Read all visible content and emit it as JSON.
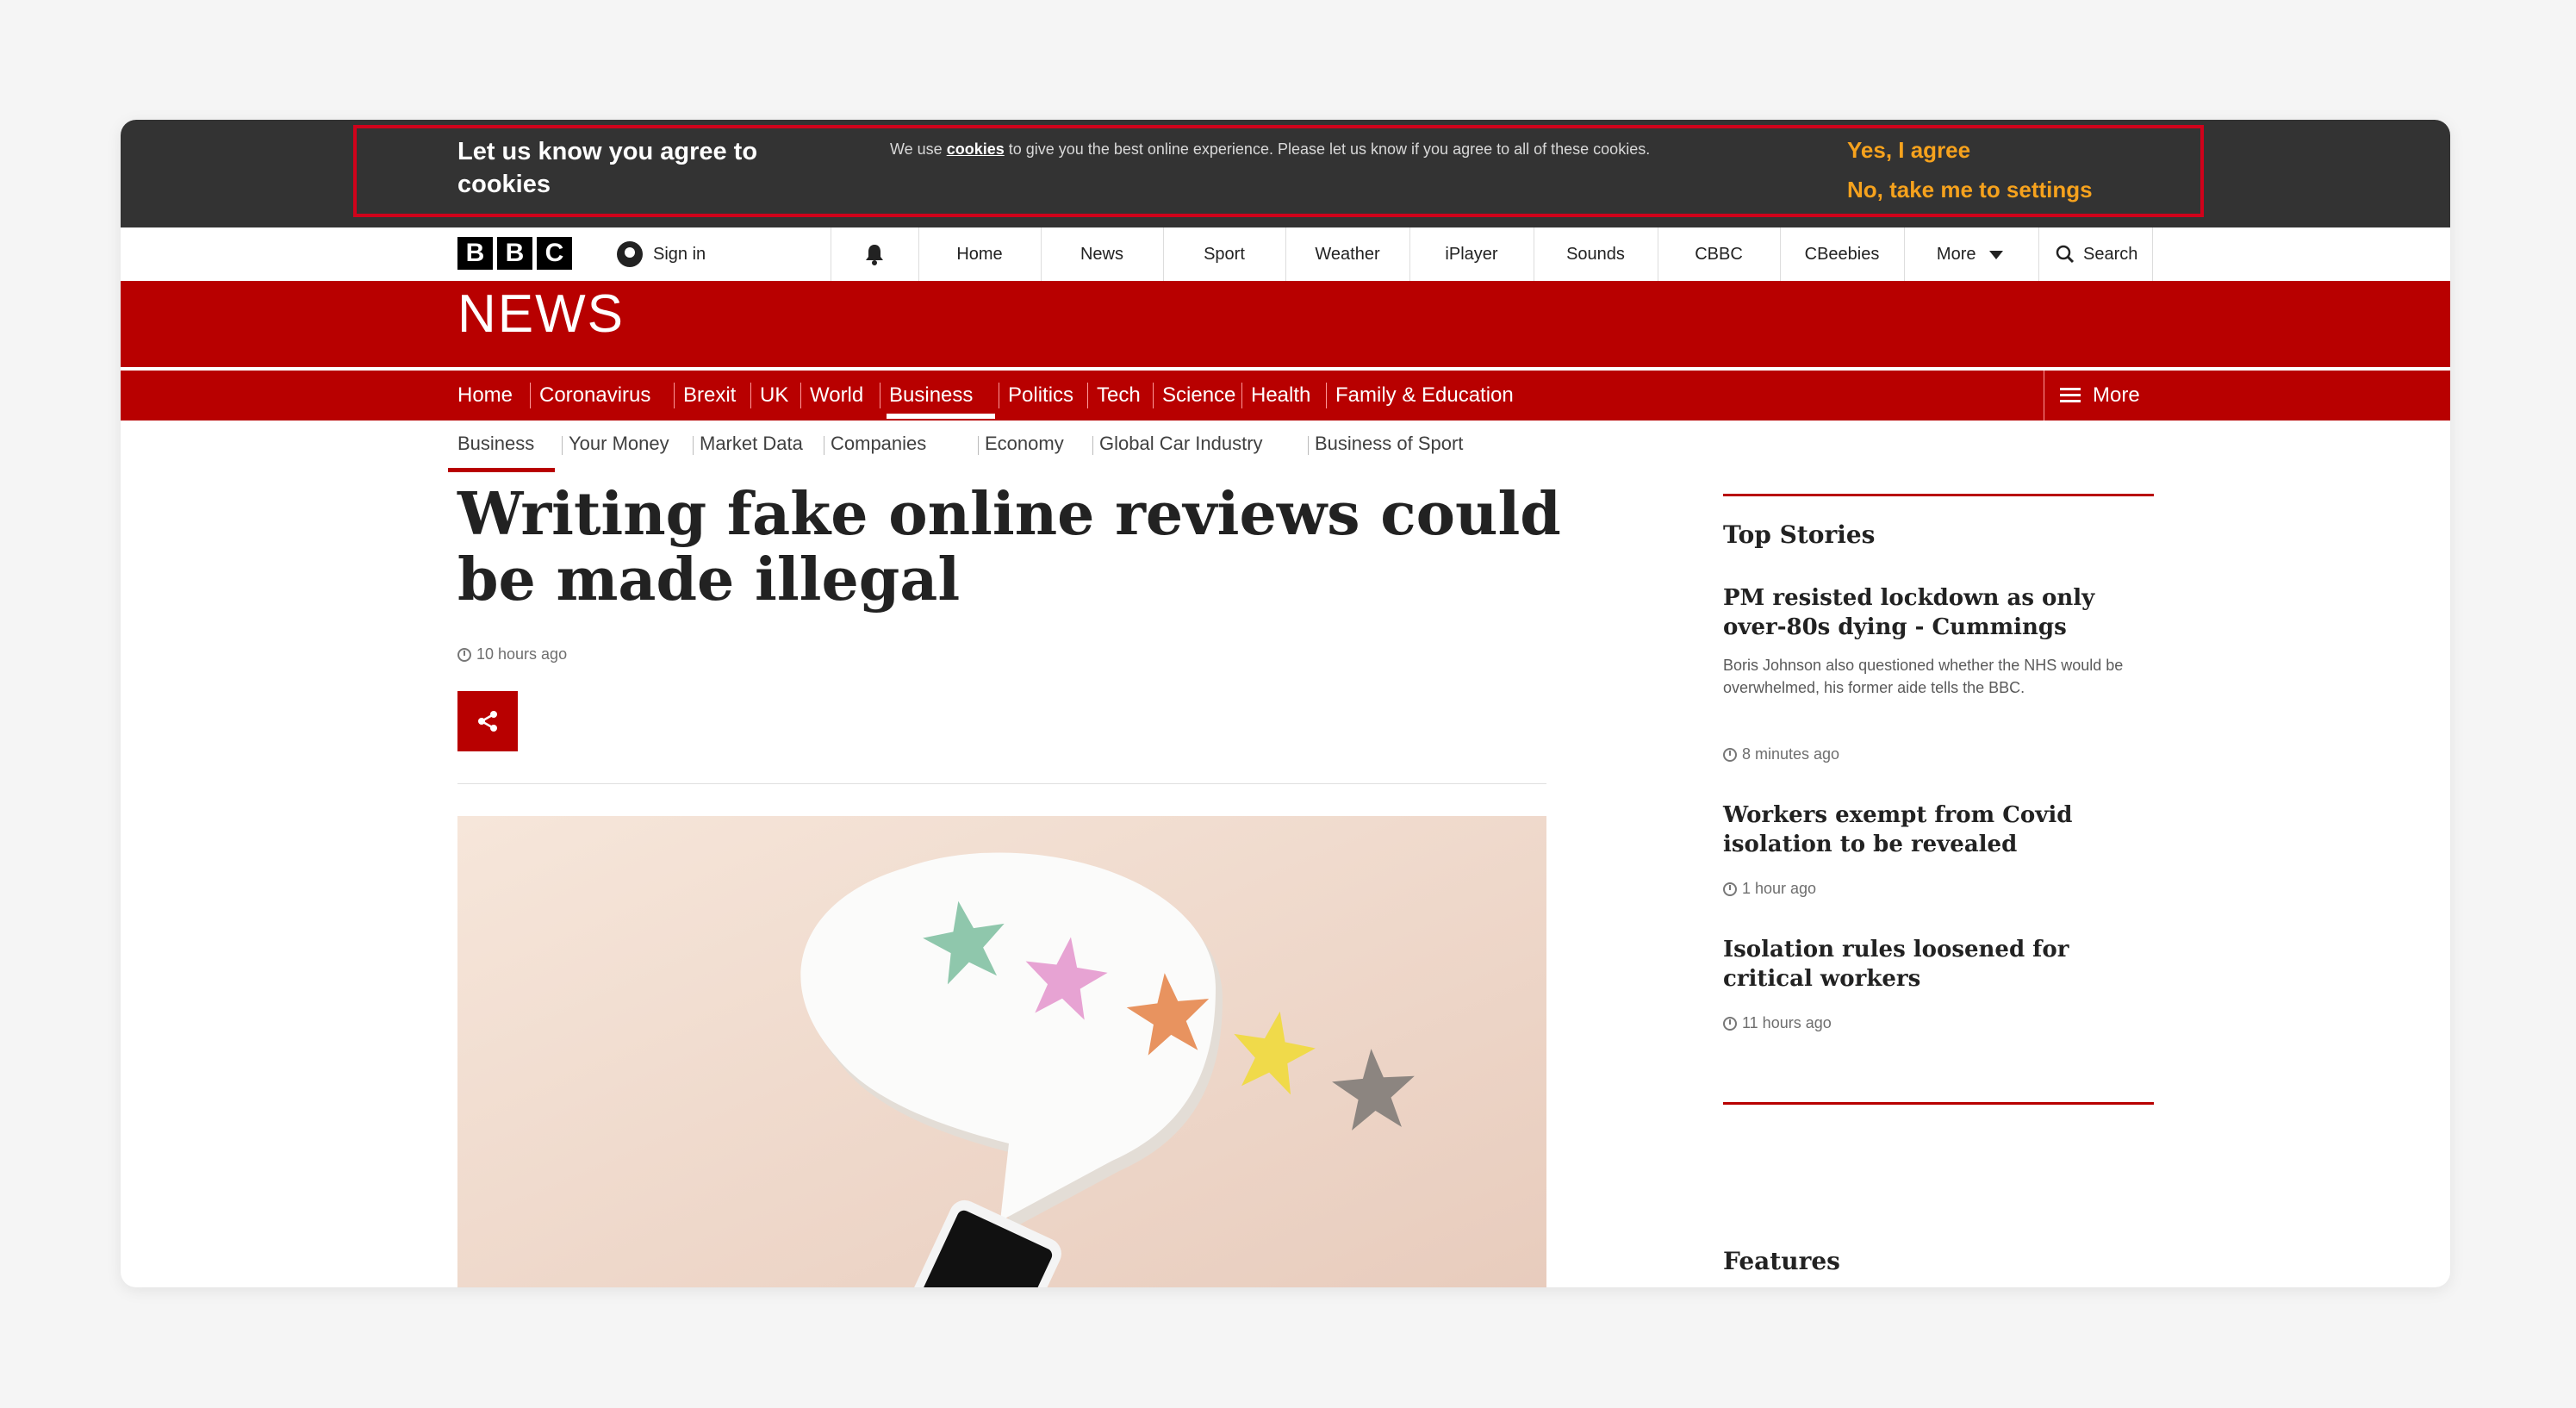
{
  "cookie_banner": {
    "title": "Let us know you agree to cookies",
    "text_before": "We use ",
    "link": "cookies",
    "text_after": " to give you the best online experience. Please let us know if you agree to all of these cookies.",
    "yes_label": "Yes, I agree",
    "no_label": "No, take me to settings"
  },
  "topnav": {
    "logo": [
      "B",
      "B",
      "C"
    ],
    "signin": "Sign in",
    "items": [
      "Home",
      "News",
      "Sport",
      "Weather",
      "iPlayer",
      "Sounds",
      "CBBC",
      "CBeebies"
    ],
    "more": "More",
    "search": "Search"
  },
  "news": {
    "title": "NEWS",
    "nav": [
      "Home",
      "Coronavirus",
      "Brexit",
      "UK",
      "World",
      "Business",
      "Politics",
      "Tech",
      "Science",
      "Health",
      "Family & Education"
    ],
    "active": "Business",
    "more": "More"
  },
  "subnav": [
    "Business",
    "Your Money",
    "Market Data",
    "Companies",
    "Economy",
    "Global Car Industry",
    "Business of Sport"
  ],
  "article": {
    "headline": "Writing fake online reviews could be made illegal",
    "timestamp": "10 hours ago"
  },
  "sidebar": {
    "top_stories_heading": "Top Stories",
    "stories": [
      {
        "title": "PM resisted lockdown as only over-80s dying - Cummings",
        "summary": "Boris Johnson also questioned whether the NHS would be overwhelmed, his former aide tells the BBC.",
        "time": "8 minutes ago"
      },
      {
        "title": "Workers exempt from Covid isolation to be revealed",
        "time": "1 hour ago"
      },
      {
        "title": "Isolation rules loosened for critical workers",
        "time": "11 hours ago"
      }
    ],
    "features_heading": "Features"
  },
  "colors": {
    "bbc_red": "#b80000",
    "cookie_bg": "#333333",
    "cookie_accent": "#f6a21d"
  }
}
